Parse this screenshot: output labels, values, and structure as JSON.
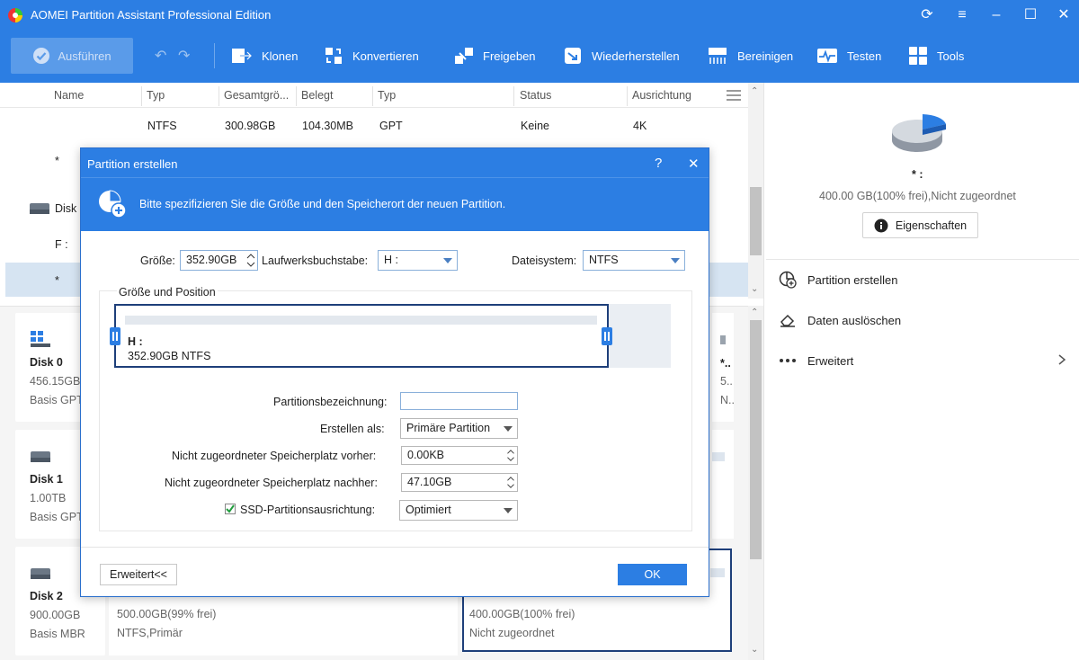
{
  "app": {
    "title": "AOMEI Partition Assistant Professional Edition"
  },
  "toolbar": {
    "run_label": "Ausführen",
    "items": [
      "Klonen",
      "Konvertieren",
      "Freigeben",
      "Wiederherstellen",
      "Bereinigen",
      "Testen",
      "Tools"
    ]
  },
  "grid": {
    "headers": [
      "Name",
      "Typ",
      "Gesamtgrö...",
      "Belegt",
      "Typ",
      "Status",
      "Ausrichtung"
    ],
    "row1": [
      "NTFS",
      "300.98GB",
      "104.30MB",
      "GPT",
      "Keine",
      "4K"
    ],
    "row_star": "*",
    "disk_label": "Disk",
    "f_label": "F :",
    "sel_label": "*"
  },
  "disks": [
    {
      "name": "Disk 0",
      "size": "456.15GB",
      "type": "Basis GPT"
    },
    {
      "name": "Disk 1",
      "size": "1.00TB",
      "type": "Basis GPT"
    },
    {
      "name": "Disk 2",
      "size": "900.00GB",
      "type": "Basis MBR"
    }
  ],
  "disk_parts": {
    "disk0_right_name": "*..",
    "disk0_right_size": "5..",
    "disk0_right_fs": "N..",
    "disk2_p1_size": "500.00GB(99% frei)",
    "disk2_p1_fs": "NTFS,Primär",
    "disk2_p2_size": "400.00GB(100% frei)",
    "disk2_p2_fs": "Nicht zugeordnet"
  },
  "info": {
    "star": "* :",
    "summary": "400.00 GB(100% frei),Nicht zugeordnet",
    "properties_label": "Eigenschaften",
    "ops": [
      "Partition erstellen",
      "Daten auslöschen",
      "Erweitert"
    ]
  },
  "dialog": {
    "title": "Partition erstellen",
    "help": "?",
    "close": "✕",
    "description": "Bitte spezifizieren Sie die Größe und den Speicherort der neuen Partition.",
    "size_label": "Größe:",
    "size_value": "352.90GB",
    "drive_label": "Laufwerksbuchstabe:",
    "drive_value": "H :",
    "fs_label": "Dateisystem:",
    "fs_value": "NTFS",
    "group_label": "Größe und Position",
    "bar_letter": "H :",
    "bar_info": "352.90GB NTFS",
    "label_label": "Partitionsbezeichnung:",
    "label_value": "",
    "create_as_label": "Erstellen als:",
    "create_as_value": "Primäre Partition",
    "before_label": "Nicht zugeordneter Speicherplatz vorher:",
    "before_value": "0.00KB",
    "after_label": "Nicht zugeordneter Speicherplatz nachher:",
    "after_value": "47.10GB",
    "ssd_label": "SSD-Partitionsausrichtung:",
    "ssd_checked": true,
    "ssd_value": "Optimiert",
    "advanced_button": "Erweitert<<",
    "ok_button": "OK"
  },
  "colors": {
    "accent": "#2c7ee3",
    "selection": "#d6e4f2"
  }
}
